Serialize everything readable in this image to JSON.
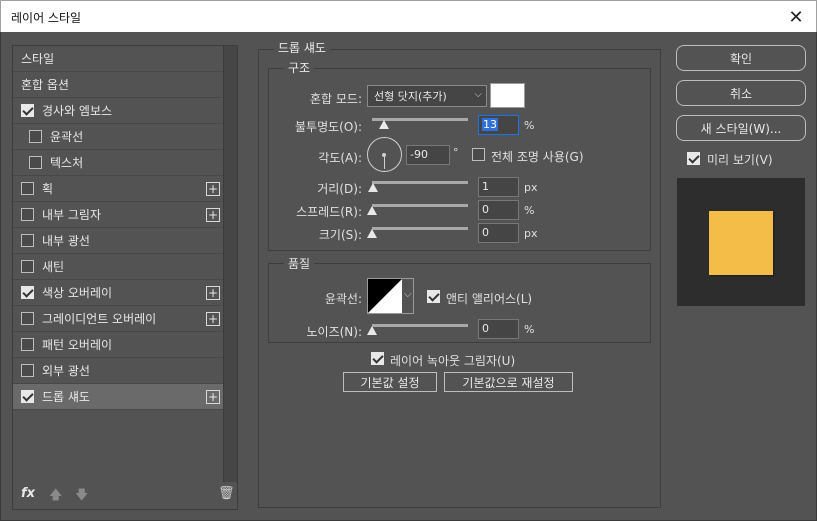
{
  "window": {
    "title": "레이어 스타일"
  },
  "styles": [
    {
      "label": "스타일",
      "checkbox": false,
      "checked": false,
      "plus": false,
      "sub": false,
      "selected": false
    },
    {
      "label": "혼합 옵션",
      "checkbox": false,
      "checked": false,
      "plus": false,
      "sub": false,
      "selected": false
    },
    {
      "label": "경사와 엠보스",
      "checkbox": true,
      "checked": true,
      "plus": false,
      "sub": false,
      "selected": false
    },
    {
      "label": "윤곽선",
      "checkbox": true,
      "checked": false,
      "plus": false,
      "sub": true,
      "selected": false
    },
    {
      "label": "텍스처",
      "checkbox": true,
      "checked": false,
      "plus": false,
      "sub": true,
      "selected": false
    },
    {
      "label": "획",
      "checkbox": true,
      "checked": false,
      "plus": true,
      "sub": false,
      "selected": false
    },
    {
      "label": "내부 그림자",
      "checkbox": true,
      "checked": false,
      "plus": true,
      "sub": false,
      "selected": false
    },
    {
      "label": "내부 광선",
      "checkbox": true,
      "checked": false,
      "plus": false,
      "sub": false,
      "selected": false
    },
    {
      "label": "새틴",
      "checkbox": true,
      "checked": false,
      "plus": false,
      "sub": false,
      "selected": false
    },
    {
      "label": "색상 오버레이",
      "checkbox": true,
      "checked": true,
      "plus": true,
      "sub": false,
      "selected": false
    },
    {
      "label": "그레이디언트 오버레이",
      "checkbox": true,
      "checked": false,
      "plus": true,
      "sub": false,
      "selected": false
    },
    {
      "label": "패턴 오버레이",
      "checkbox": true,
      "checked": false,
      "plus": false,
      "sub": false,
      "selected": false
    },
    {
      "label": "외부 광선",
      "checkbox": true,
      "checked": false,
      "plus": false,
      "sub": false,
      "selected": false
    },
    {
      "label": "드롭 섀도",
      "checkbox": true,
      "checked": true,
      "plus": true,
      "sub": false,
      "selected": true
    }
  ],
  "panel": {
    "title": "드롭 섀도",
    "structure": {
      "legend": "구조",
      "blend_mode_label": "혼합 모드:",
      "blend_mode_value": "선형 닷지(추가)",
      "blend_color": "#ffffff",
      "opacity_label": "불투명도(O):",
      "opacity_value": "13",
      "opacity_unit": "%",
      "opacity_level": 0.13,
      "angle_label": "각도(A):",
      "angle_value": "-90",
      "angle_unit": "°",
      "global_light_label": "전체 조명 사용(G)",
      "global_light_checked": false,
      "distance_label": "거리(D):",
      "distance_value": "1",
      "distance_unit": "px",
      "spread_label": "스프레드(R):",
      "spread_value": "0",
      "spread_unit": "%",
      "size_label": "크기(S):",
      "size_value": "0",
      "size_unit": "px"
    },
    "quality": {
      "legend": "품질",
      "contour_label": "윤곽선:",
      "antialias_label": "앤티 앨리어스(L)",
      "antialias_checked": true,
      "noise_label": "노이즈(N):",
      "noise_value": "0",
      "noise_unit": "%"
    },
    "knockout_label": "레이어 녹아웃 그림자(U)",
    "knockout_checked": true,
    "make_default_label": "기본값 설정",
    "reset_default_label": "기본값으로 재설정"
  },
  "actions": {
    "ok": "확인",
    "cancel": "취소",
    "new_style": "새 스타일(W)...",
    "preview_label": "미리 보기(V)",
    "preview_checked": true
  },
  "preview_color": "#f4bd48"
}
